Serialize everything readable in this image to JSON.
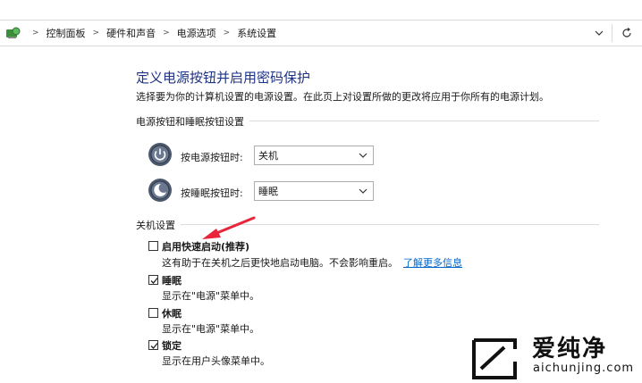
{
  "breadcrumbs": [
    "控制面板",
    "硬件和声音",
    "电源选项",
    "系统设置"
  ],
  "page": {
    "title": "定义电源按钮并启用密码保护",
    "description": "选择要为你的计算机设置的电源设置。在此页上对设置所做的更改将应用于你所有的电源计划。"
  },
  "power_group": {
    "label": "电源按钮和睡眠按钮设置",
    "power_button": {
      "label": "按电源按钮时:",
      "value": "关机"
    },
    "sleep_button": {
      "label": "按睡眠按钮时:",
      "value": "睡眠"
    }
  },
  "shutdown_group": {
    "label": "关机设置",
    "options": [
      {
        "label": "启用快速启动(推荐)",
        "desc": "这有助于在关机之后更快地启动电脑。不会影响重启。",
        "link": "了解更多信息",
        "checked": false
      },
      {
        "label": "睡眠",
        "desc": "显示在\"电源\"菜单中。",
        "checked": true
      },
      {
        "label": "休眠",
        "desc": "显示在\"电源\"菜单中。",
        "checked": false
      },
      {
        "label": "锁定",
        "desc": "显示在用户头像菜单中。",
        "checked": true
      }
    ]
  },
  "watermark": {
    "name": "爱纯净",
    "url": "aichunjing.com"
  },
  "colors": {
    "title": "#1e3287",
    "link": "#0066cc",
    "arrow": "#e8253a"
  }
}
